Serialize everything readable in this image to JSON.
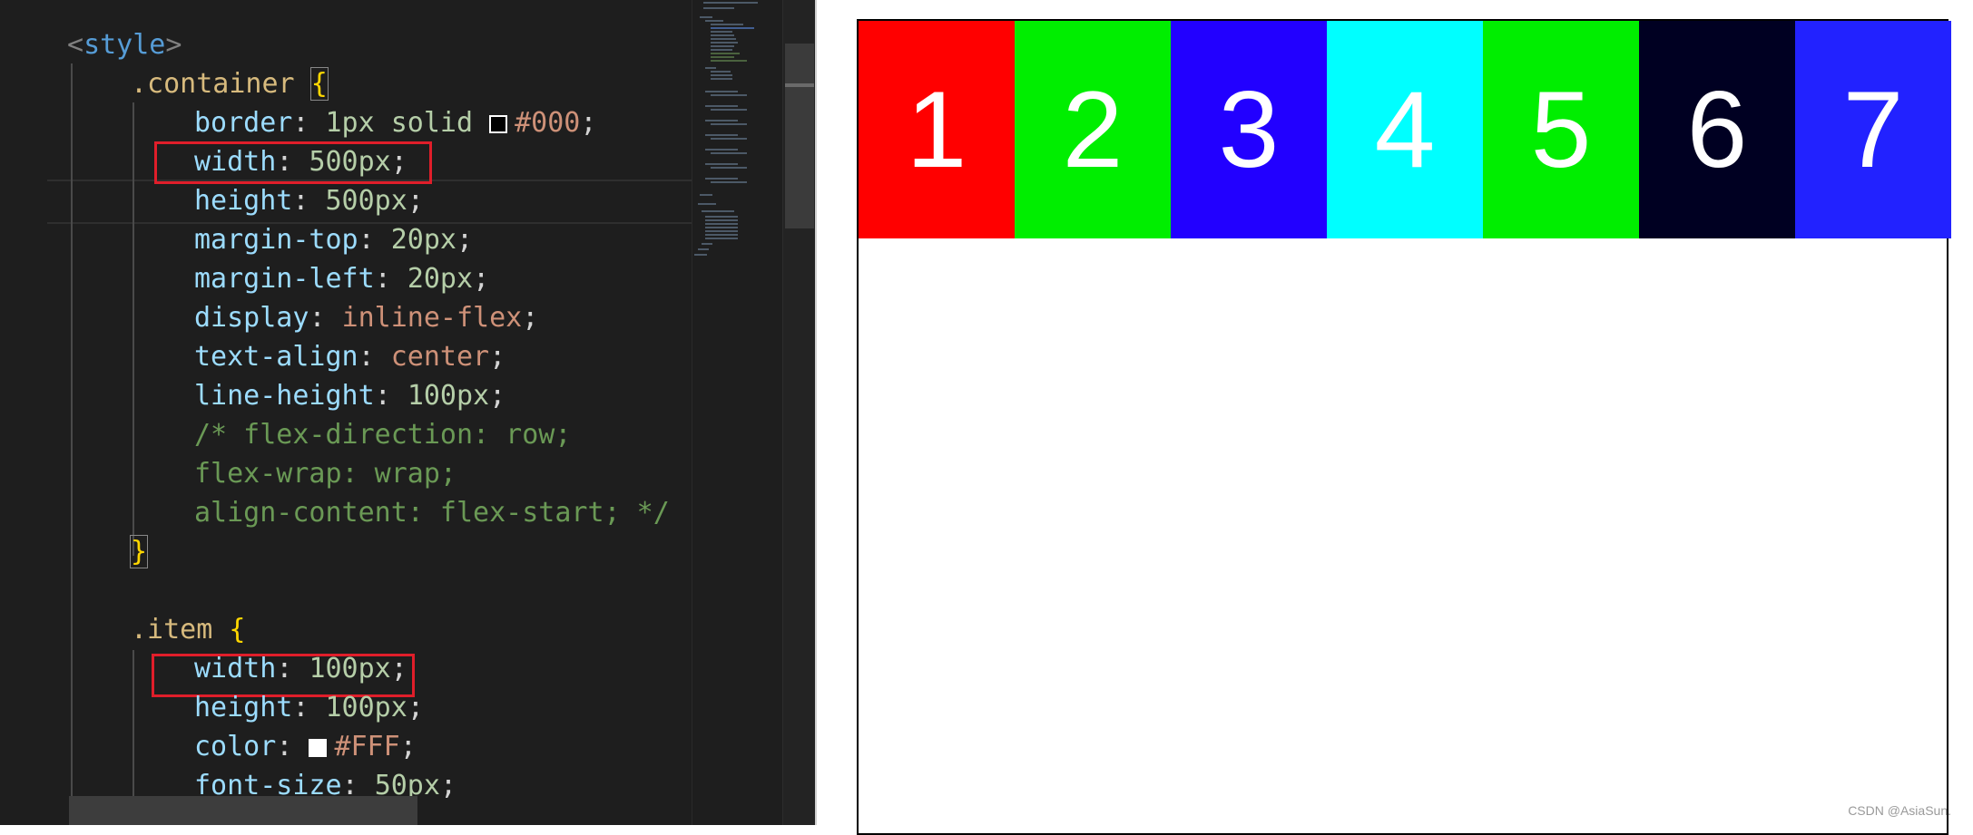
{
  "editor": {
    "lines": {
      "style_open": {
        "open": "<",
        "tag": "style",
        "close": ">"
      },
      "container_selector": ".container",
      "brace_open": "{",
      "brace_close": "}",
      "border": {
        "prop": "border",
        "sep": ": ",
        "value": "1px solid ",
        "color": "#000",
        "end": ";"
      },
      "container_width": {
        "prop": "width",
        "sep": ": ",
        "value": "500px",
        "end": ";"
      },
      "container_height": {
        "prop": "height",
        "sep": ": ",
        "value": "500px",
        "end": ";"
      },
      "margin_top": {
        "prop": "margin-top",
        "sep": ": ",
        "value": "20px",
        "end": ";"
      },
      "margin_left": {
        "prop": "margin-left",
        "sep": ": ",
        "value": "20px",
        "end": ";"
      },
      "display": {
        "prop": "display",
        "sep": ": ",
        "value": "inline-flex",
        "end": ";"
      },
      "text_align": {
        "prop": "text-align",
        "sep": ": ",
        "value": "center",
        "end": ";"
      },
      "line_height": {
        "prop": "line-height",
        "sep": ": ",
        "value": "100px",
        "end": ";"
      },
      "comment_1": "/* flex-direction: row;",
      "comment_2": "flex-wrap: wrap;",
      "comment_3": "align-content: flex-start; */",
      "item_selector": ".item",
      "item_width": {
        "prop": "width",
        "sep": ": ",
        "value": "100px",
        "end": ";"
      },
      "item_height": {
        "prop": "height",
        "sep": ": ",
        "value": "100px",
        "end": ";"
      },
      "item_color": {
        "prop": "color",
        "sep": ": ",
        "color": "#FFF",
        "end": ";"
      },
      "font_size": {
        "prop": "font-size",
        "sep": ": ",
        "value": "50px",
        "end": ";"
      }
    }
  },
  "preview": {
    "items": [
      {
        "label": "1",
        "color": "#ff0000"
      },
      {
        "label": "2",
        "color": "#00ee00"
      },
      {
        "label": "3",
        "color": "#2200ff"
      },
      {
        "label": "4",
        "color": "#00ffff"
      },
      {
        "label": "5",
        "color": "#00ee00"
      },
      {
        "label": "6",
        "color": "#000022"
      },
      {
        "label": "7",
        "color": "#2222ff"
      }
    ],
    "watermark": "CSDN @AsiaSun."
  }
}
